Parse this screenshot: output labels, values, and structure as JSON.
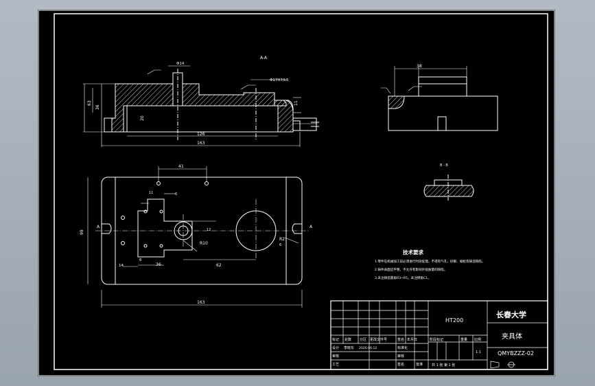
{
  "section_label": "A-A",
  "view_labels": {
    "b_view": "B - B"
  },
  "dimensions": {
    "top_width": "163",
    "inner_width": "126",
    "height_outer": "63",
    "height_inner": "36",
    "depth": "20",
    "step": "11",
    "bore_dia": "Φ14",
    "bore_fit": "Φ17H7/k6",
    "right_38": "38",
    "plan_41": "41",
    "plan_11": "11",
    "plan_6a": "6",
    "plan_99": "99",
    "plan_6b": "6",
    "plan_14": "14",
    "plan_36": "36",
    "plan_62": "62",
    "plan_163": "163",
    "plan_r10": "R10",
    "plan_r2": "R2",
    "plan_6c": "6",
    "plan_12": "12",
    "section_mark": "A"
  },
  "tech": {
    "title": "技术要求",
    "lines": [
      "1.零件在机械加工前必须进行时效处理，不得有气孔、砂眼、缩松等铸造缺陷。",
      "2.铸件表面应平整，不允许有影响外观质量的缺陷。",
      "3.未注铸造圆角R3~R5，未注倒角C1。"
    ]
  },
  "title_block": {
    "material": "HT200",
    "school": "长春大学",
    "part_name": "夹具体",
    "drawing_no": "QMYBZZZ-02",
    "row_labels": [
      "标记",
      "处数",
      "分区",
      "更改文件号",
      "签名",
      "年月日"
    ],
    "designer_label": "设计",
    "designer": "李晓东",
    "date": "2020.06.12",
    "std_label": "标准化",
    "review_label": "审核",
    "process_label": "工艺",
    "approve_label": "批准",
    "check_label": "审核",
    "sign_label": "签名",
    "stage_headers": [
      "阶段标记",
      "重量",
      "比例"
    ],
    "scale": "1:1",
    "sheets": "共 1 张  第 1 张"
  }
}
